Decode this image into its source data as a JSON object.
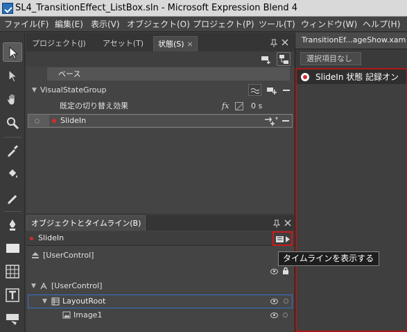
{
  "window": {
    "title": "SL4_TransitionEffect_ListBox.sln - Microsoft Expression Blend 4"
  },
  "menu": [
    "ファイル(F)",
    "編集(E)",
    "表示(V)",
    "オブジェクト(O)",
    "プロジェクト(P)",
    "ツール(T)",
    "ウィンドウ(W)",
    "ヘルプ(H)"
  ],
  "top_panel": {
    "tabs": [
      "プロジェクト(J)",
      "アセット(T)",
      "状態(S)"
    ],
    "base_label": "ベース",
    "group_name": "VisualStateGroup",
    "default_transition_label": "既定の切り替え効果",
    "transition_fx": "fx",
    "transition_time": "0 s",
    "state_name": "SlideIn"
  },
  "document": {
    "tab_title": "TransitionEf...ageShow.xam",
    "selection_label": "選択項目なし",
    "recording_text": "SlideIn 状態 記録オン"
  },
  "objects_panel": {
    "title": "オブジェクトとタイムライン(B)",
    "current_state": "SlideIn",
    "tooltip": "タイムラインを表示する",
    "scope_root": "[UserControl]",
    "tree": [
      {
        "label": "[UserControl]",
        "icon": "usercontrol-icon"
      },
      {
        "label": "LayoutRoot",
        "icon": "grid-icon"
      },
      {
        "label": "Image1",
        "icon": "image-icon"
      }
    ]
  },
  "colors": {
    "record_red": "#d42c2c",
    "highlight_blue": "#3b6fc8",
    "frame_red": "#b01818"
  }
}
